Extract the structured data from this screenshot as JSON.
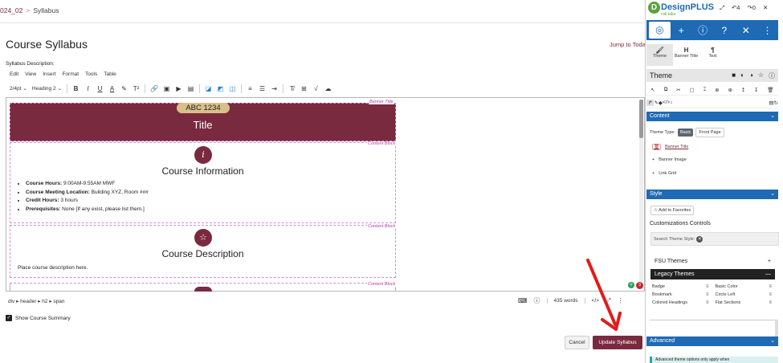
{
  "breadcrumb": {
    "course": "024_02",
    "separator": ">",
    "page": "Syllabus"
  },
  "page": {
    "title": "Course Syllabus",
    "jump_link": "Jump to Today",
    "syllabus_label": "Syllabus Description:"
  },
  "editor_menu": [
    "Edit",
    "View",
    "Insert",
    "Format",
    "Tools",
    "Table"
  ],
  "toolbar": {
    "font_size": "2/4pt",
    "block_format": "Heading 2",
    "buttons": [
      "B",
      "I",
      "U",
      "A",
      "T²"
    ]
  },
  "content": {
    "banner_tag": "Banner Title",
    "course_code": "ABC 1234",
    "banner_title": "Title",
    "block_tag": "Content Block",
    "info_icon": "i",
    "info_title": "Course Information",
    "info_items": [
      {
        "label": "Course Hours:",
        "value": " 9:00AM-9:55AM MWF"
      },
      {
        "label": "Course Meeting Location:",
        "value": " Building XYZ, Room ###"
      },
      {
        "label": "Credit Hours:",
        "value": " 3 hours"
      },
      {
        "label": "Prerequisites:",
        "value": " None [If any exist, please list them.]"
      }
    ],
    "desc_title": "Course Description",
    "desc_text": "Place course description here."
  },
  "status": {
    "path": "div ▸ header ▸ h2 ▸ span",
    "words": "435 words",
    "code_view": "</>"
  },
  "badges": {
    "red_count": "3"
  },
  "summary_checkbox": {
    "label": "Show Course Summary",
    "checked": true
  },
  "actions": {
    "cancel": "Cancel",
    "update": "Update Syllabus"
  },
  "panel": {
    "brand": "DesignPLUS",
    "brand_sub": "cidi labs",
    "header_icons": [
      "⤢",
      "↶4",
      "↷0",
      "✕"
    ],
    "tabs": [
      {
        "icon": "🖌",
        "label": "Theme"
      },
      {
        "icon": "H",
        "label": "Banner Title"
      },
      {
        "icon": "¶",
        "label": "Text"
      }
    ],
    "theme_heading": "Theme",
    "sections": {
      "content": "Content",
      "style": "Style",
      "advanced": "Advanced"
    },
    "theme_type_label": "Theme Type:",
    "theme_type_options": [
      "Basic",
      "Front Page"
    ],
    "content_items": [
      "Banner Title",
      "Banner Image",
      "Link Grid"
    ],
    "add_favorites": "Add to Favorites",
    "customizations_label": "Customizations Controls",
    "search_theme": "Search Theme Style:",
    "fsu_themes": "FSU Themes",
    "legacy_themes": "Legacy Themes",
    "themes": [
      "Badge",
      "Basic Color",
      "Bookmark",
      "Circle Left",
      "Colored Headings",
      "Flat Sections"
    ],
    "advanced_note": "Advanced theme options only apply when"
  },
  "colors": {
    "maroon": "#7a2a3f",
    "gold": "#d9c08a",
    "panel_blue": "#1e6ab5",
    "arrow_red": "#e31b1b"
  }
}
